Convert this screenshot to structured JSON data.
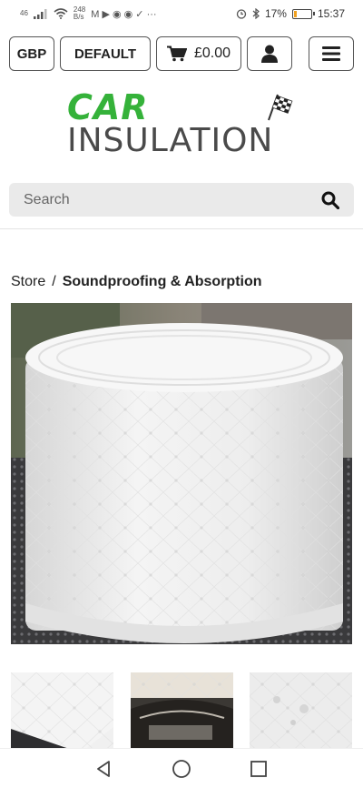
{
  "status_bar": {
    "network": "46",
    "speed_value": "248",
    "speed_unit": "B/s",
    "app_glyphs": "M ▶ ◉ ◉ ✓ ···",
    "battery": "17%",
    "battery_level": 0.17,
    "time": "15:37"
  },
  "topbar": {
    "currency_label": "GBP",
    "language_label": "DEFAULT",
    "cart_total": "£0.00"
  },
  "logo": {
    "line1": "CAR",
    "line2": "INSULATION",
    "primary_color": "#35b23a",
    "secondary_color": "#4a4a4a"
  },
  "search": {
    "placeholder": "Search"
  },
  "breadcrumb": {
    "store_label": "Store",
    "separator": "/",
    "current": "Soundproofing & Absorption"
  },
  "colors": {
    "accent": "#222222",
    "search_bg": "#eaeaea"
  }
}
